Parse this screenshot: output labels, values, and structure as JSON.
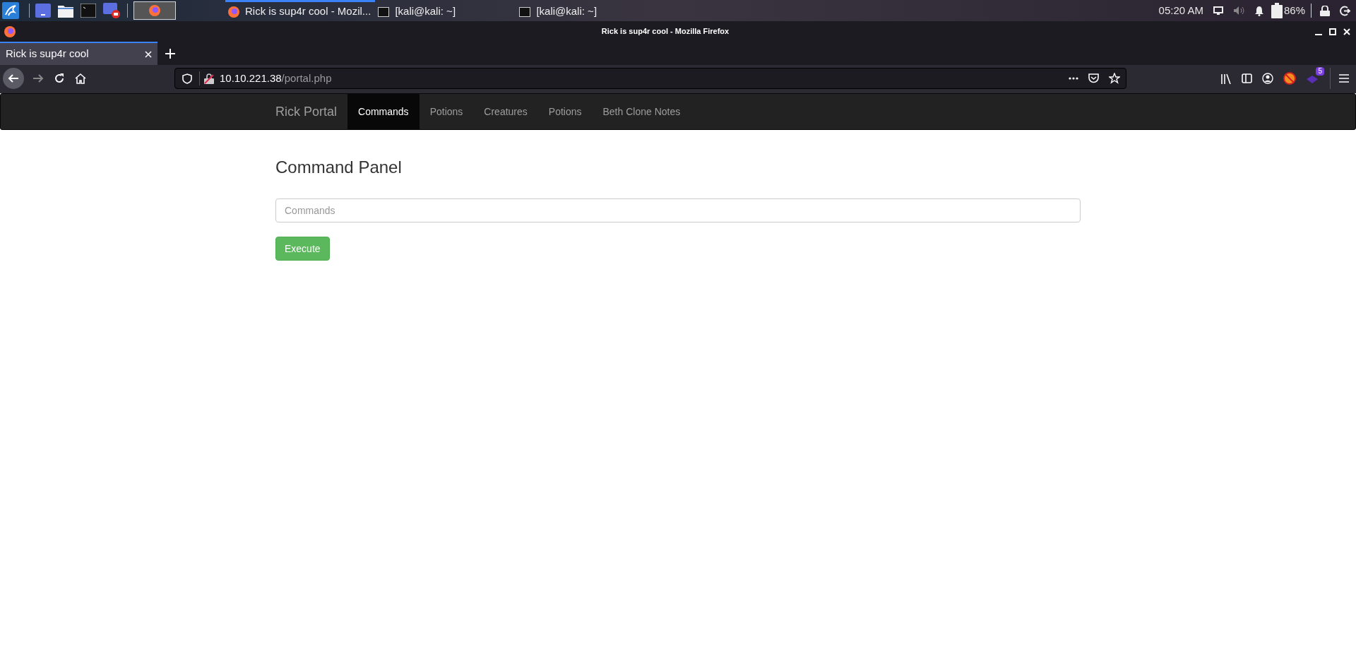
{
  "taskbar": {
    "tasks": [
      {
        "kind": "browser",
        "label": "Rick is sup4r cool - Mozil...",
        "selected": true
      },
      {
        "kind": "terminal",
        "label": "[kali@kali: ~]",
        "selected": false
      },
      {
        "kind": "terminal",
        "label": "[kali@kali: ~]",
        "selected": false
      }
    ],
    "clock": "05:20 AM",
    "battery": "86%"
  },
  "window": {
    "title": "Rick is sup4r cool - Mozilla Firefox"
  },
  "tabs": [
    {
      "label": "Rick is sup4r cool",
      "selected": true
    }
  ],
  "address_bar": {
    "host": "10.10.221.38",
    "path": "/portal.php"
  },
  "toolbar": {
    "extension_badge": "5"
  },
  "navbar": {
    "brand": "Rick Portal",
    "items": [
      {
        "label": "Commands",
        "selected": true
      },
      {
        "label": "Potions",
        "selected": false
      },
      {
        "label": "Creatures",
        "selected": false
      },
      {
        "label": "Potions",
        "selected": false
      },
      {
        "label": "Beth Clone Notes",
        "selected": false
      }
    ]
  },
  "page": {
    "heading": "Command Panel",
    "command_field": {
      "placeholder": "Commands"
    },
    "button": "Execute"
  }
}
